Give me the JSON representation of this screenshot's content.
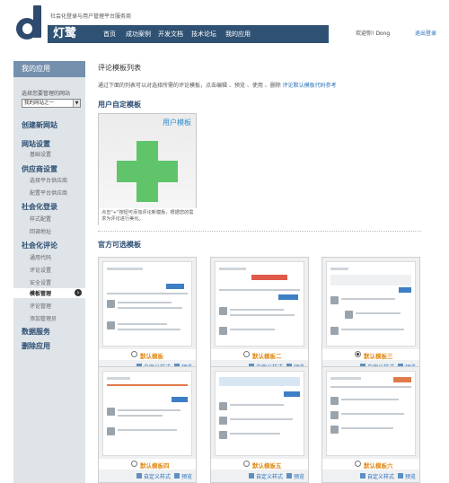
{
  "header": {
    "tagline": "社会化登录与用户管理平台服务商",
    "brand": "灯鹭",
    "nav": [
      "首页",
      "成功案例",
      "开发文档",
      "技术论坛",
      "我的应用"
    ],
    "welcome": "欢迎你! Dong",
    "logout": "退出登录"
  },
  "sidebar": {
    "title": "我的应用",
    "select_label": "选择您要管理的网站",
    "select_value": "我的网站之一",
    "create_site": "创建新网站",
    "sections": [
      {
        "label": "网站设置",
        "items": [
          "基础设置"
        ]
      },
      {
        "label": "供应商设置",
        "items": [
          "选择平台供应商",
          "配置平台供应商"
        ]
      },
      {
        "label": "社会化登录",
        "items": [
          "样式配置",
          "回调地址"
        ]
      },
      {
        "label": "社会化评论",
        "items": [
          "通用代码",
          "评论设置",
          "安全设置",
          "模板管理",
          "评论管理",
          "添加管理员"
        ]
      }
    ],
    "active_item": "模板管理",
    "data_service": "数据服务",
    "delete_app": "删除应用"
  },
  "main": {
    "heading": "评论模板列表",
    "intro": "通过下面的列表可以对选择所需的评论模板，点击编辑 、预览 、使用 、删除",
    "intro_link": "评论默认模板代码参考",
    "custom_section": "用户自定模板",
    "custom_caption": "用户模板",
    "custom_note": "点击\"+\"按钮可添加评论新模板，根据您的需求为评论进行美化。",
    "official_section": "官方可选模板",
    "edit_label": "自定义样式",
    "preview_label": "预览",
    "templates": [
      {
        "name": "默认模板",
        "checked": false
      },
      {
        "name": "默认模板二",
        "checked": false
      },
      {
        "name": "默认模板三",
        "checked": true
      },
      {
        "name": "默认模板四",
        "checked": false
      },
      {
        "name": "默认模板五",
        "checked": false
      },
      {
        "name": "默认模板六",
        "checked": false
      }
    ]
  },
  "colors": {
    "brand_blue": "#2f5274",
    "sidebar_bg": "#dfe4e8",
    "accent_orange": "#e08a16",
    "plus_green": "#5fc46a"
  }
}
